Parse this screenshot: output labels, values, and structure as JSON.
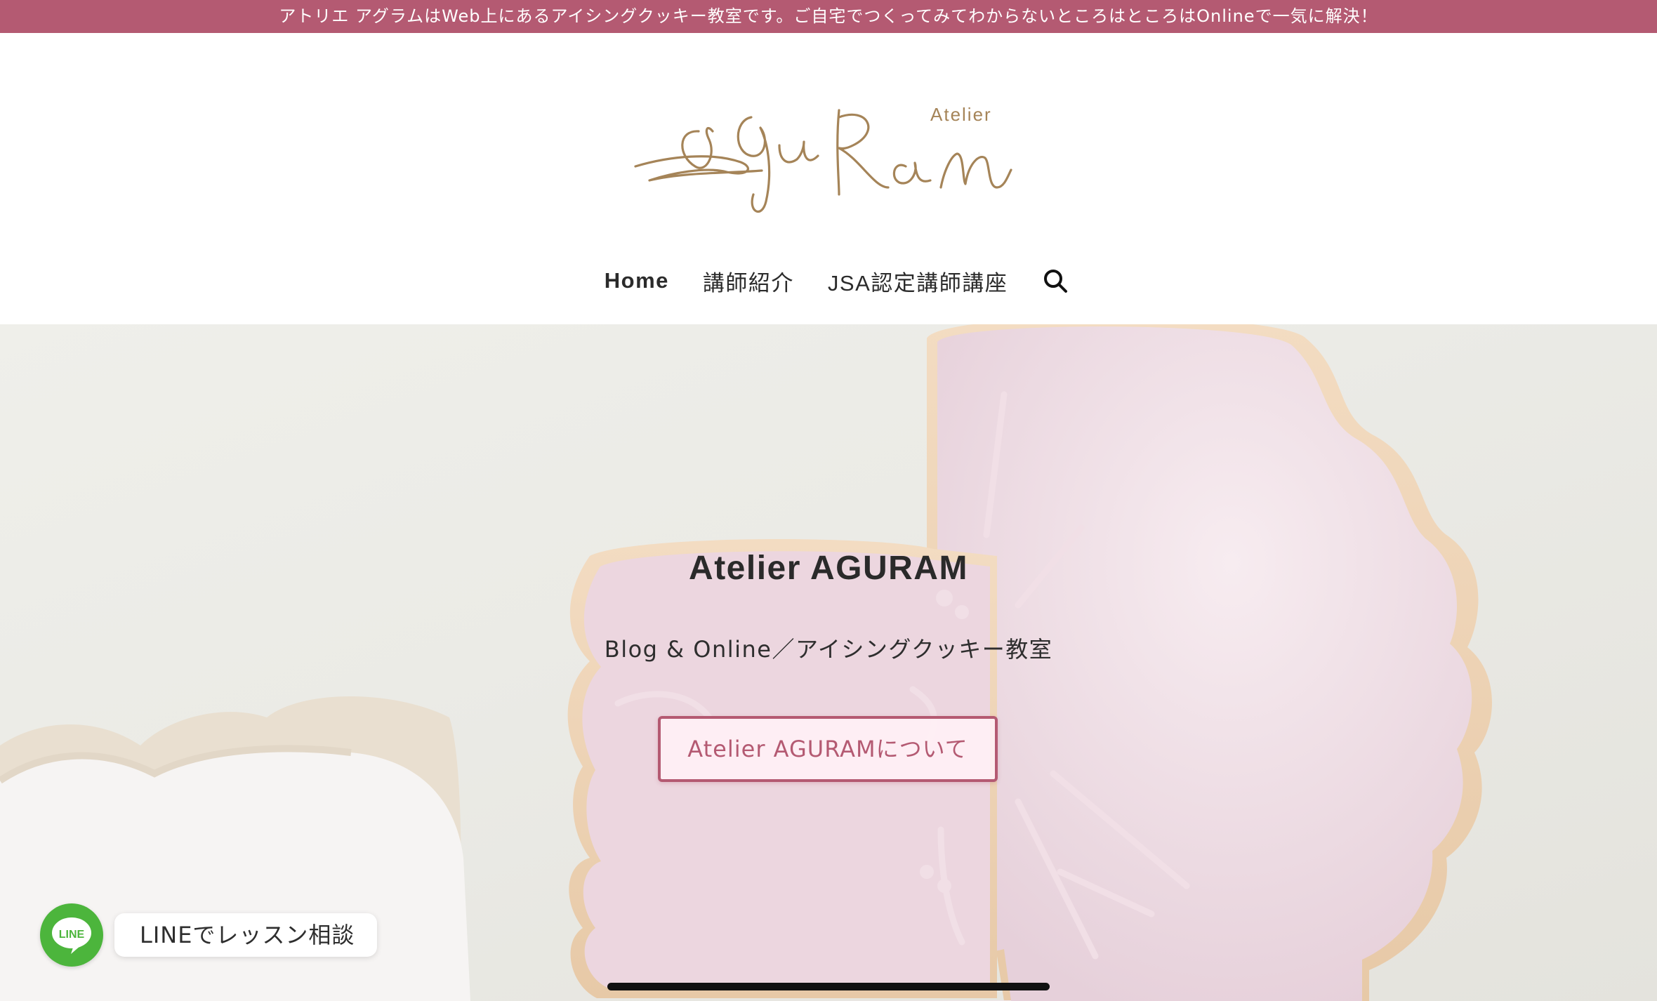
{
  "topbar": {
    "text": "アトリエ アグラムはWeb上にあるアイシングクッキー教室です。ご自宅でつくってみてわからないところはところはOnlineで一気に解決！"
  },
  "logo": {
    "small_text": "Atelier"
  },
  "nav": {
    "items": [
      {
        "label": "Home"
      },
      {
        "label": "講師紹介"
      },
      {
        "label": "JSA認定講師講座"
      }
    ],
    "search_icon": "search-icon"
  },
  "hero": {
    "title": "Atelier AGURAM",
    "subtitle": "Blog & Online／アイシングクッキー教室",
    "button_label": "Atelier AGURAMについて"
  },
  "line_widget": {
    "icon_text": "LINE",
    "label": "LINEでレッスン相談"
  },
  "colors": {
    "accent": "#b45a72",
    "logo_gold": "#a58458",
    "line_green": "#4cb53c"
  }
}
